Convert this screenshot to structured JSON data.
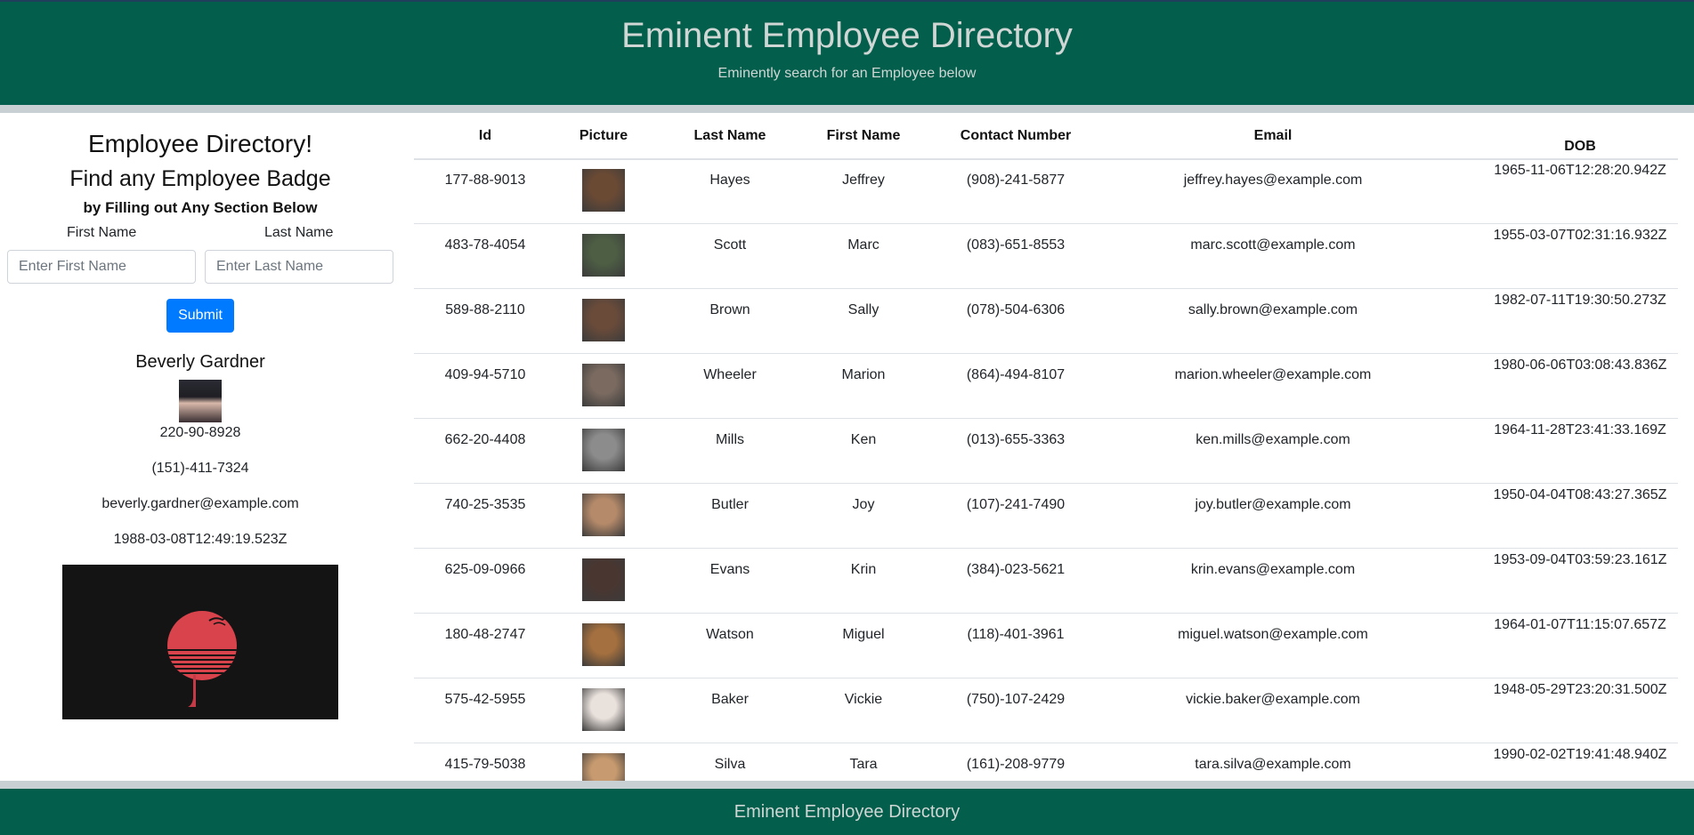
{
  "header": {
    "title": "Eminent Employee Directory",
    "subtitle": "Eminently search for an Employee below"
  },
  "sidebar": {
    "heading": "Employee Directory!",
    "subheading": "Find any Employee Badge",
    "instruction": "by Filling out Any Section Below",
    "first_name_label": "First Name",
    "last_name_label": "Last Name",
    "first_name_placeholder": "Enter First Name",
    "last_name_placeholder": "Enter Last Name",
    "first_name_value": "",
    "last_name_value": "",
    "submit_label": "Submit"
  },
  "selected_employee": {
    "name": "Beverly Gardner",
    "id": "220-90-8928",
    "phone": "(151)-411-7324",
    "email": "beverly.gardner@example.com",
    "dob": "1988-03-08T12:49:19.523Z"
  },
  "table": {
    "columns": [
      "Id",
      "Picture",
      "Last Name",
      "First Name",
      "Contact Number",
      "Email",
      "DOB"
    ],
    "rows": [
      {
        "id": "177-88-9013",
        "last": "Hayes",
        "first": "Jeffrey",
        "phone": "(908)-241-5877",
        "email": "jeffrey.hayes@example.com",
        "dob": "1965-11-06T12:28:20.942Z",
        "photo_color": "#6b4a34"
      },
      {
        "id": "483-78-4054",
        "last": "Scott",
        "first": "Marc",
        "phone": "(083)-651-8553",
        "email": "marc.scott@example.com",
        "dob": "1955-03-07T02:31:16.932Z",
        "photo_color": "#4d5e44"
      },
      {
        "id": "589-88-2110",
        "last": "Brown",
        "first": "Sally",
        "phone": "(078)-504-6306",
        "email": "sally.brown@example.com",
        "dob": "1982-07-11T19:30:50.273Z",
        "photo_color": "#6a4b3a"
      },
      {
        "id": "409-94-5710",
        "last": "Wheeler",
        "first": "Marion",
        "phone": "(864)-494-8107",
        "email": "marion.wheeler@example.com",
        "dob": "1980-06-06T03:08:43.836Z",
        "photo_color": "#7a6a60"
      },
      {
        "id": "662-20-4408",
        "last": "Mills",
        "first": "Ken",
        "phone": "(013)-655-3363",
        "email": "ken.mills@example.com",
        "dob": "1964-11-28T23:41:33.169Z",
        "photo_color": "#8c8c8c"
      },
      {
        "id": "740-25-3535",
        "last": "Butler",
        "first": "Joy",
        "phone": "(107)-241-7490",
        "email": "joy.butler@example.com",
        "dob": "1950-04-04T08:43:27.365Z",
        "photo_color": "#b58a6a"
      },
      {
        "id": "625-09-0966",
        "last": "Evans",
        "first": "Krin",
        "phone": "(384)-023-5621",
        "email": "krin.evans@example.com",
        "dob": "1953-09-04T03:59:23.161Z",
        "photo_color": "#4a3630"
      },
      {
        "id": "180-48-2747",
        "last": "Watson",
        "first": "Miguel",
        "phone": "(118)-401-3961",
        "email": "miguel.watson@example.com",
        "dob": "1964-01-07T11:15:07.657Z",
        "photo_color": "#a5703f"
      },
      {
        "id": "575-42-5955",
        "last": "Baker",
        "first": "Vickie",
        "phone": "(750)-107-2429",
        "email": "vickie.baker@example.com",
        "dob": "1948-05-29T23:20:31.500Z",
        "photo_color": "#e9e1dc"
      },
      {
        "id": "415-79-5038",
        "last": "Silva",
        "first": "Tara",
        "phone": "(161)-208-9779",
        "email": "tara.silva@example.com",
        "dob": "1990-02-02T19:41:48.940Z",
        "photo_color": "#c79a6f"
      }
    ]
  },
  "footer": {
    "title": "Eminent Employee Directory"
  },
  "colors": {
    "brand_green": "#035e4c",
    "band_gray": "#c9d0d3",
    "submit_blue": "#007bff"
  }
}
